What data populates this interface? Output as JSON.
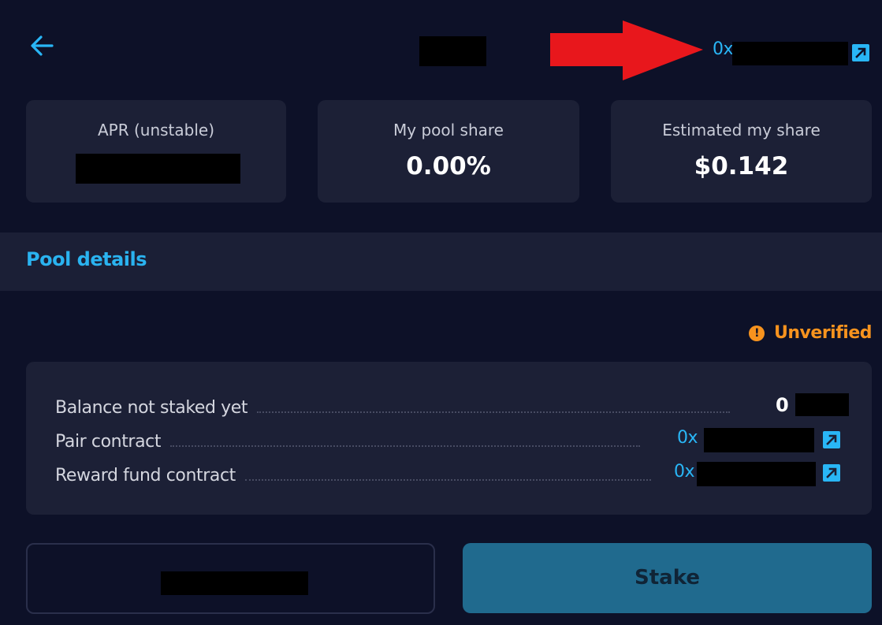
{
  "header": {
    "back_icon": "arrow-left-icon",
    "contract_address_prefix": "0x",
    "external_link_icon": "external-link-icon",
    "annotation_arrow_color": "#e8171c"
  },
  "stats": {
    "apr_label": "APR (unstable)",
    "pool_share_label": "My pool share",
    "pool_share_value": "0.00%",
    "estimated_label": "Estimated my share",
    "estimated_value": "$0.142"
  },
  "pool_details": {
    "title": "Pool details",
    "status_icon": "warning-circle-icon",
    "status_text": "Unverified",
    "rows": {
      "balance_label": "Balance not staked yet",
      "balance_value": "0",
      "pair_label": "Pair contract",
      "pair_value_prefix": "0x",
      "reward_label": "Reward fund contract",
      "reward_value_prefix": "0x"
    }
  },
  "actions": {
    "stake_label": "Stake"
  },
  "colors": {
    "background": "#0d1128",
    "card": "#1c2036",
    "accent": "#29b6f6",
    "warning": "#f7931e",
    "stake_button": "#206a8e"
  }
}
